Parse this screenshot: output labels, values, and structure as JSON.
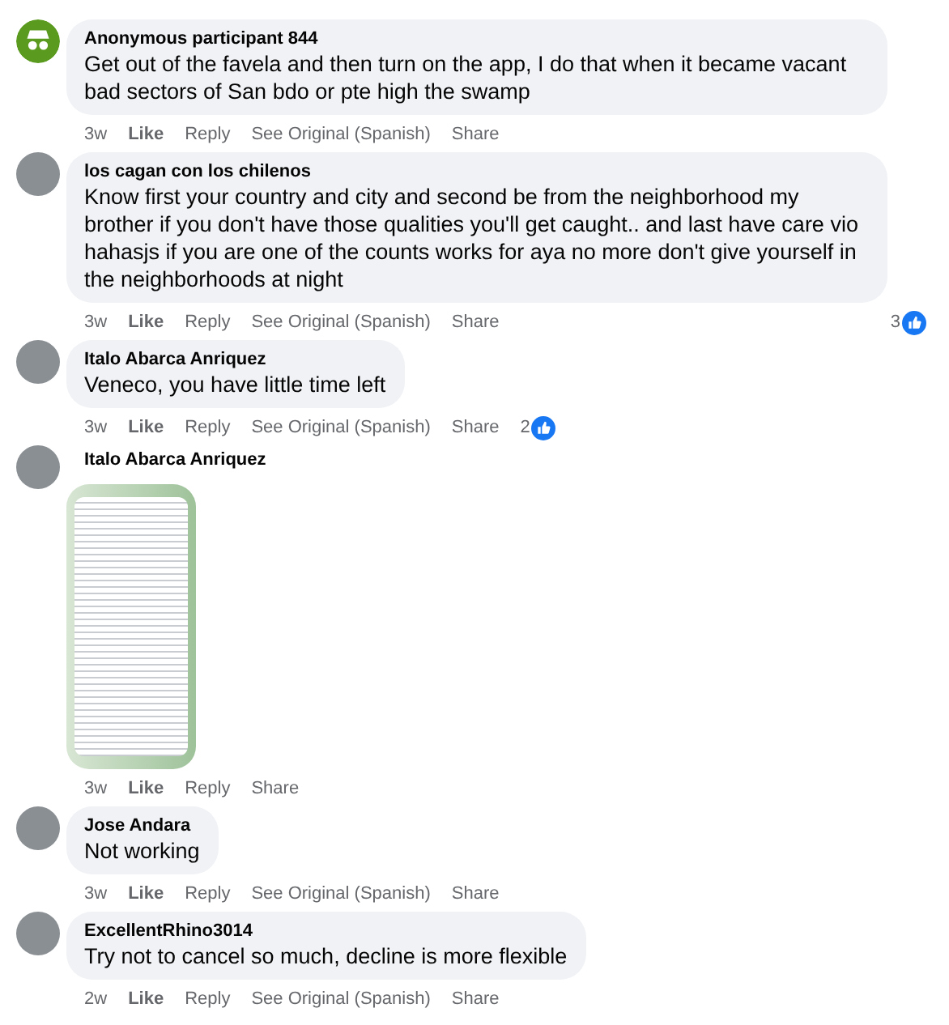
{
  "comments": [
    {
      "kind": "text",
      "avatar": {
        "kind": "anonymous"
      },
      "author": "Anonymous participant 844",
      "text": "Get out of the favela and then turn on the app, I do that when it became vacant bad sectors of San bdo or pte high the swamp",
      "time": "3w",
      "actions": [
        "Like",
        "Reply",
        "See Original (Spanish)",
        "Share"
      ]
    },
    {
      "kind": "text",
      "avatar": {
        "kind": "photo"
      },
      "author": "los cagan con los chilenos",
      "text": "Know first your country and city and second be from the neighborhood my brother if you don't have those qualities you'll get caught.. and last have care vio hahasjs if you are one of the counts works for aya no more don't give yourself in the neighborhoods at night",
      "time": "3w",
      "actions": [
        "Like",
        "Reply",
        "See Original (Spanish)",
        "Share"
      ],
      "reactions": {
        "count": "3",
        "kind": "end"
      }
    },
    {
      "kind": "text",
      "avatar": {
        "kind": "photo"
      },
      "author": "Italo Abarca Anriquez",
      "text": "Veneco, you have little time left",
      "time": "3w",
      "actions": [
        "Like",
        "Reply",
        "See Original (Spanish)",
        "Share"
      ],
      "reactions": {
        "count": "2",
        "kind": "inline"
      }
    },
    {
      "kind": "image",
      "avatar": {
        "kind": "photo"
      },
      "author": "Italo Abarca Anriquez",
      "time": "3w",
      "actions": [
        "Like",
        "Reply",
        "Share"
      ]
    },
    {
      "kind": "text",
      "avatar": {
        "kind": "photo"
      },
      "author": "Jose Andara",
      "text": "Not working",
      "time": "3w",
      "actions": [
        "Like",
        "Reply",
        "See Original (Spanish)",
        "Share"
      ]
    },
    {
      "kind": "text",
      "avatar": {
        "kind": "photo"
      },
      "author": "ExcellentRhino3014",
      "text": "Try not to cancel so much, decline is more flexible",
      "time": "2w",
      "actions": [
        "Like",
        "Reply",
        "See Original (Spanish)",
        "Share"
      ]
    }
  ]
}
